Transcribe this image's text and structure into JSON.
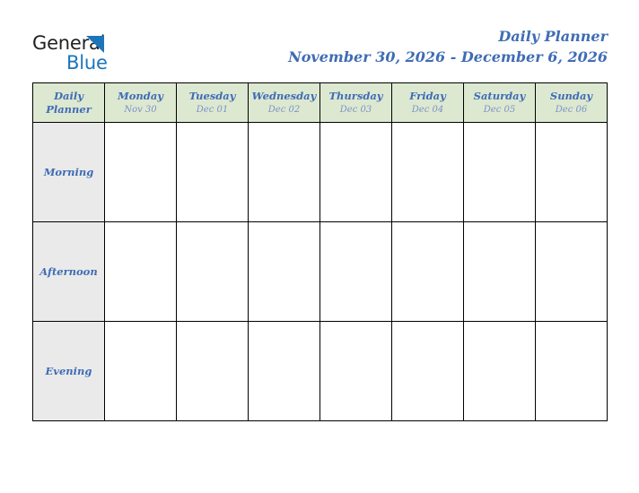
{
  "brand": {
    "logo_text_primary": "General",
    "logo_text_secondary": "Blue",
    "logo_mark": "triangle-icon",
    "primary_color": "#1b75bb",
    "text_color": "#231f20"
  },
  "header": {
    "title": "Daily Planner",
    "date_range": "November 30, 2026 - December 6, 2026",
    "title_color": "#3f6cb5"
  },
  "planner": {
    "corner_label_line1": "Daily",
    "corner_label_line2": "Planner",
    "header_bg_color": "#dde8d1",
    "period_bg_color": "#eaeaea",
    "grid_line_color": "#000000",
    "day_name_color": "#3f6cb5",
    "day_date_color": "#7a93c4",
    "columns": [
      {
        "name": "Monday",
        "date": "Nov 30"
      },
      {
        "name": "Tuesday",
        "date": "Dec 01"
      },
      {
        "name": "Wednesday",
        "date": "Dec 02"
      },
      {
        "name": "Thursday",
        "date": "Dec 03"
      },
      {
        "name": "Friday",
        "date": "Dec 04"
      },
      {
        "name": "Saturday",
        "date": "Dec 05"
      },
      {
        "name": "Sunday",
        "date": "Dec 06"
      }
    ],
    "rows": [
      {
        "label": "Morning",
        "cells": [
          "",
          "",
          "",
          "",
          "",
          "",
          ""
        ]
      },
      {
        "label": "Afternoon",
        "cells": [
          "",
          "",
          "",
          "",
          "",
          "",
          ""
        ]
      },
      {
        "label": "Evening",
        "cells": [
          "",
          "",
          "",
          "",
          "",
          "",
          ""
        ]
      }
    ]
  }
}
